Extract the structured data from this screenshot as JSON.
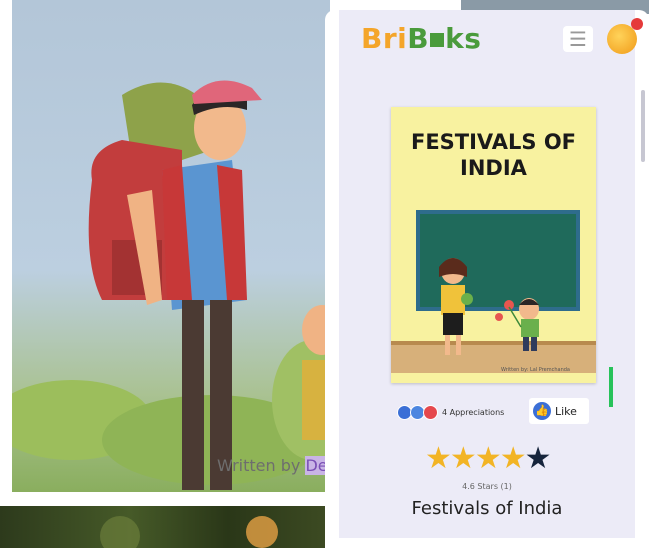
{
  "background": {
    "written_by_prefix": "Written by",
    "written_by_name": "De"
  },
  "header": {
    "logo_part1": "Bri",
    "logo_part2": "B",
    "logo_part3": "ks",
    "menu_icon": "hamburger-icon",
    "avatar_icon": "user-avatar"
  },
  "book": {
    "cover_title_line1": "FESTIVALS OF",
    "cover_title_line2": "INDIA",
    "cover_author": "Written by: Lal Premchanda"
  },
  "reactions": {
    "appreciations": "4 Appreciations",
    "like_label": "Like"
  },
  "rating": {
    "stars_filled": 4,
    "stars_total": 5,
    "stars_text": "4.6 Stars (1)"
  },
  "title": "Festivals of India",
  "colors": {
    "brand_orange": "#f4a52a",
    "brand_green": "#4a9b3c",
    "star": "#f2b425",
    "like_blue": "#3b6fd6"
  }
}
